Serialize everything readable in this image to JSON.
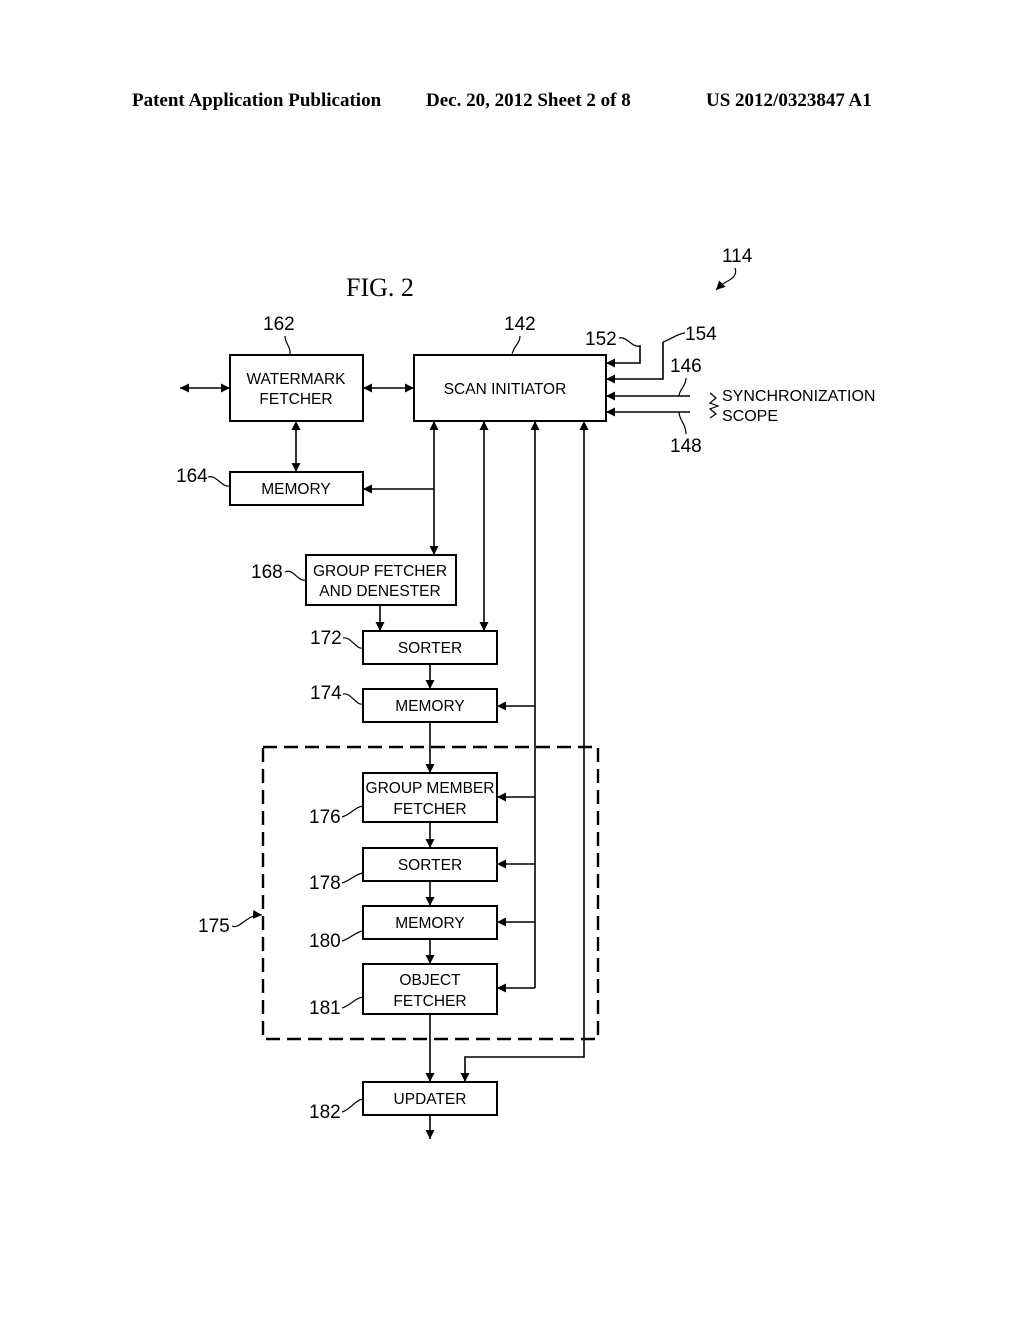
{
  "header": {
    "left": "Patent Application Publication",
    "middle": "Dec. 20, 2012   Sheet 2 of 8",
    "right": "US 2012/0323847 A1"
  },
  "figure": {
    "title": "FIG. 2",
    "system_ref": "114",
    "boxes": {
      "watermark_fetcher": {
        "ref": "162",
        "line1": "WATERMARK",
        "line2": "FETCHER"
      },
      "scan_initiator": {
        "ref": "142",
        "line1": "SCAN INITIATOR"
      },
      "memory_164": {
        "ref": "164",
        "line1": "MEMORY"
      },
      "group_fetcher": {
        "ref": "168",
        "line1": "GROUP FETCHER",
        "line2": "AND DENESTER"
      },
      "sorter_172": {
        "ref": "172",
        "line1": "SORTER"
      },
      "memory_174": {
        "ref": "174",
        "line1": "MEMORY"
      },
      "group_member_fetcher": {
        "ref": "176",
        "line1": "GROUP MEMBER",
        "line2": "FETCHER"
      },
      "sorter_178": {
        "ref": "178",
        "line1": "SORTER"
      },
      "memory_180": {
        "ref": "180",
        "line1": "MEMORY"
      },
      "object_fetcher": {
        "ref": "181",
        "line1": "OBJECT",
        "line2": "FETCHER"
      },
      "updater": {
        "ref": "182",
        "line1": "UPDATER"
      }
    },
    "group_ref": "175",
    "inputs": {
      "ref_152": "152",
      "ref_154": "154",
      "ref_146": "146",
      "ref_148": "148",
      "sync_line1": "SYNCHRONIZATION",
      "sync_line2": "SCOPE"
    }
  }
}
